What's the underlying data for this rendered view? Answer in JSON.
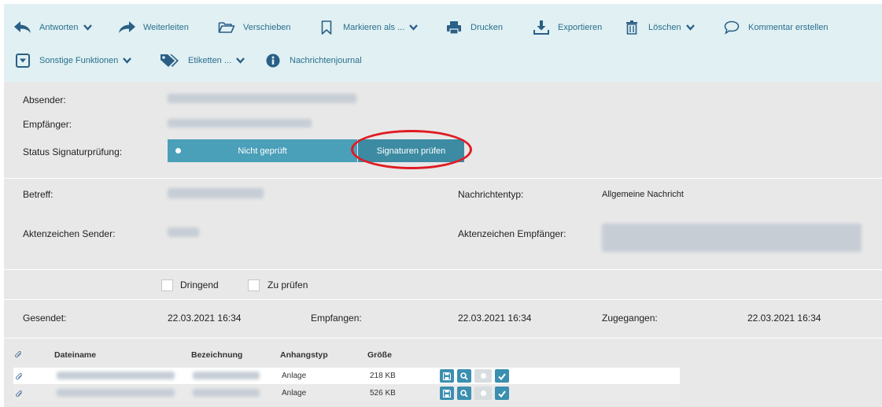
{
  "toolbar": {
    "reply": "Antworten",
    "forward": "Weiterleiten",
    "move": "Verschieben",
    "mark": "Markieren als ...",
    "print": "Drucken",
    "export": "Exportieren",
    "delete": "Löschen",
    "comment": "Kommentar erstellen",
    "other": "Sonstige Funktionen",
    "labels": "Etiketten ...",
    "journal": "Nachrichtenjournal"
  },
  "header": {
    "sender_label": "Absender:",
    "recipient_label": "Empfänger:",
    "signature_label": "Status Signaturprüfung:",
    "signature_status": "Nicht geprüft",
    "verify_button": "Signaturen prüfen"
  },
  "details": {
    "subject_label": "Betreff:",
    "msgtype_label": "Nachrichtentyp:",
    "msgtype_value": "Allgemeine Nachricht",
    "ref_sender_label": "Aktenzeichen Sender:",
    "ref_recipient_label": "Aktenzeichen Empfänger:"
  },
  "flags": {
    "urgent": "Dringend",
    "review": "Zu prüfen"
  },
  "dates": {
    "sent_label": "Gesendet:",
    "sent_value": "22.03.2021 16:34",
    "received_label": "Empfangen:",
    "received_value": "22.03.2021 16:34",
    "delivered_label": "Zugegangen:",
    "delivered_value": "22.03.2021 16:34"
  },
  "attachments": {
    "headers": [
      "Dateiname",
      "Bezeichnung",
      "Anhangstyp",
      "Größe"
    ],
    "rows": [
      {
        "type": "Anlage",
        "size": "218 KB"
      },
      {
        "type": "Anlage",
        "size": "526 KB"
      }
    ]
  },
  "colors": {
    "accent": "#3d8ba3",
    "toolbar_bg": "#e0f0f3",
    "highlight": "#e01b22"
  }
}
